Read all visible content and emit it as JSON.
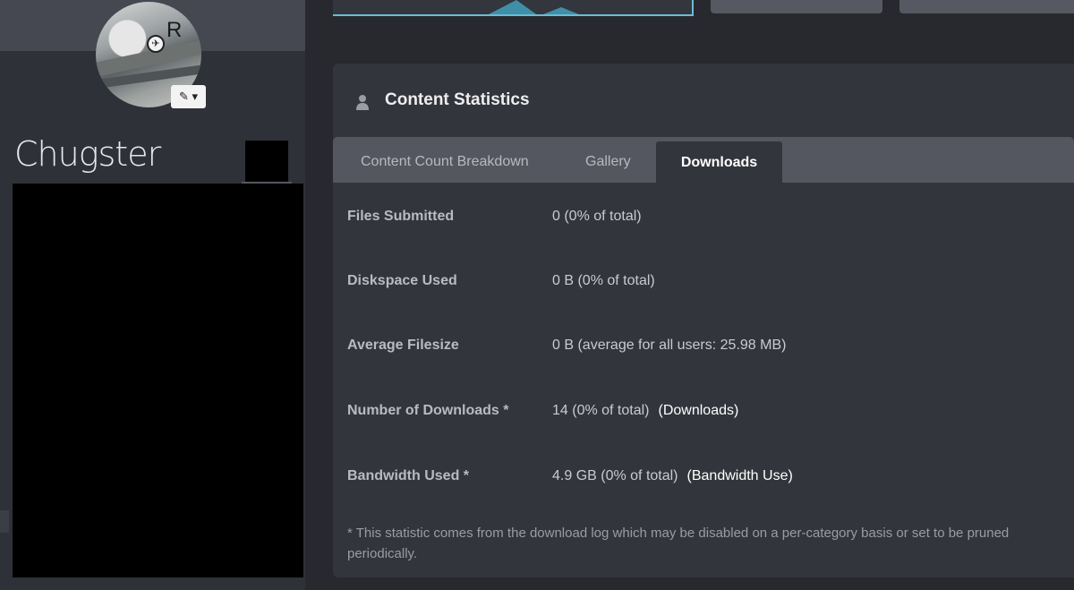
{
  "profile": {
    "avatar_letter": "R",
    "edit_label": "✎ ▾",
    "username": "Chugster"
  },
  "panel": {
    "title": "Content Statistics",
    "tabs": [
      {
        "label": "Content Count Breakdown"
      },
      {
        "label": "Gallery"
      },
      {
        "label": "Downloads"
      }
    ],
    "stats": [
      {
        "label": "Files Submitted",
        "value": "0 (0% of total)",
        "link": ""
      },
      {
        "label": "Diskspace Used",
        "value": "0 B (0% of total)",
        "link": ""
      },
      {
        "label": "Average Filesize",
        "value": "0 B (average for all users: 25.98 MB)",
        "link": ""
      },
      {
        "label": "Number of Downloads *",
        "value": "14 (0% of total)",
        "link": "(Downloads)"
      },
      {
        "label": "Bandwidth Used *",
        "value": "4.9 GB (0% of total)",
        "link": "(Bandwidth Use)"
      }
    ],
    "footnote": "* This statistic comes from the download log which may be disabled on a per-category basis or set to be pruned periodically."
  },
  "colors": {
    "accent": "#6bbcd6",
    "background": "#28292e",
    "panel": "#33353c"
  }
}
